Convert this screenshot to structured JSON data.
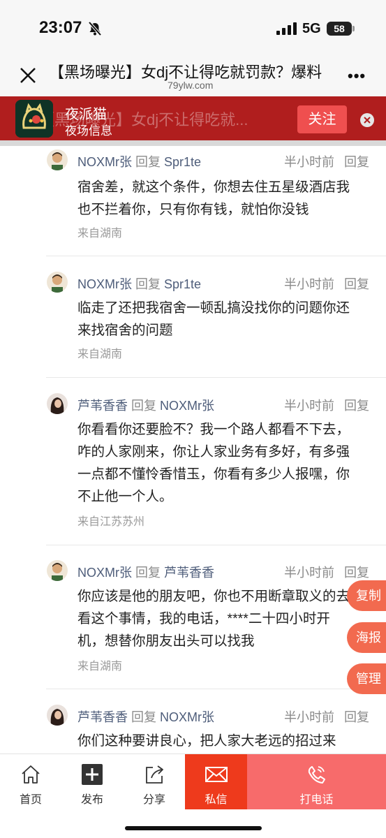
{
  "status_bar": {
    "time": "23:07",
    "network": "5G",
    "battery": "58"
  },
  "header": {
    "title": "【黑场曝光】女dj不让得吃就罚款？爆料",
    "domain": "79ylw.com"
  },
  "banner": {
    "app_name": "夜派猫",
    "app_subtitle": "夜场信息",
    "ghost_text": "【黑场曝光】女dj不让得吃就...",
    "follow_label": "关注"
  },
  "comments": [
    {
      "user": "NOXMr张",
      "reply_word": "回复",
      "reply_to": "Spr1te",
      "time": "半小时前",
      "reply_btn": "回复",
      "lines": [
        "宿舍差，就这个条件，你想去住五星级酒店我",
        "也不拦着你，只有你有钱，就怕你没钱"
      ],
      "location": "来自湖南"
    },
    {
      "user": "NOXMr张",
      "reply_word": "回复",
      "reply_to": "Spr1te",
      "time": "半小时前",
      "reply_btn": "回复",
      "lines": [
        "临走了还把我宿舍一顿乱搞没找你的问题你还",
        "来找宿舍的问题"
      ],
      "location": "来自湖南"
    },
    {
      "user": "芦苇香香",
      "reply_word": "回复",
      "reply_to": "NOXMr张",
      "time": "半小时前",
      "reply_btn": "回复",
      "lines": [
        "你看看你还要脸不？我一个路人都看不下去，",
        "咋的人家刚来，你让人家业务有多好，有多强",
        "一点都不懂怜香惜玉，你看有多少人报嘿，你",
        "不止他一个人。"
      ],
      "location": "来自江苏苏州"
    },
    {
      "user": "NOXMr张",
      "reply_word": "回复",
      "reply_to": "芦苇香香",
      "time": "半小时前",
      "reply_btn": "回复",
      "lines": [
        "你应该是他的朋友吧，你也不用断章取义的去",
        "看这个事情，我的电话，****二十四小时开",
        "机，想替你朋友出头可以找我"
      ],
      "location": "来自湖南"
    },
    {
      "user": "芦苇香香",
      "reply_word": "回复",
      "reply_to": "NOXMr张",
      "time": "半小时前",
      "reply_btn": "回复",
      "lines": [
        "你们这种要讲良心，把人家大老远的招过来"
      ],
      "location": ""
    }
  ],
  "float_buttons": {
    "copy": "复制",
    "poster": "海报",
    "manage": "管理"
  },
  "bottom_nav": {
    "home": "首页",
    "post": "发布",
    "share": "分享",
    "message": "私信",
    "call": "打电话"
  }
}
